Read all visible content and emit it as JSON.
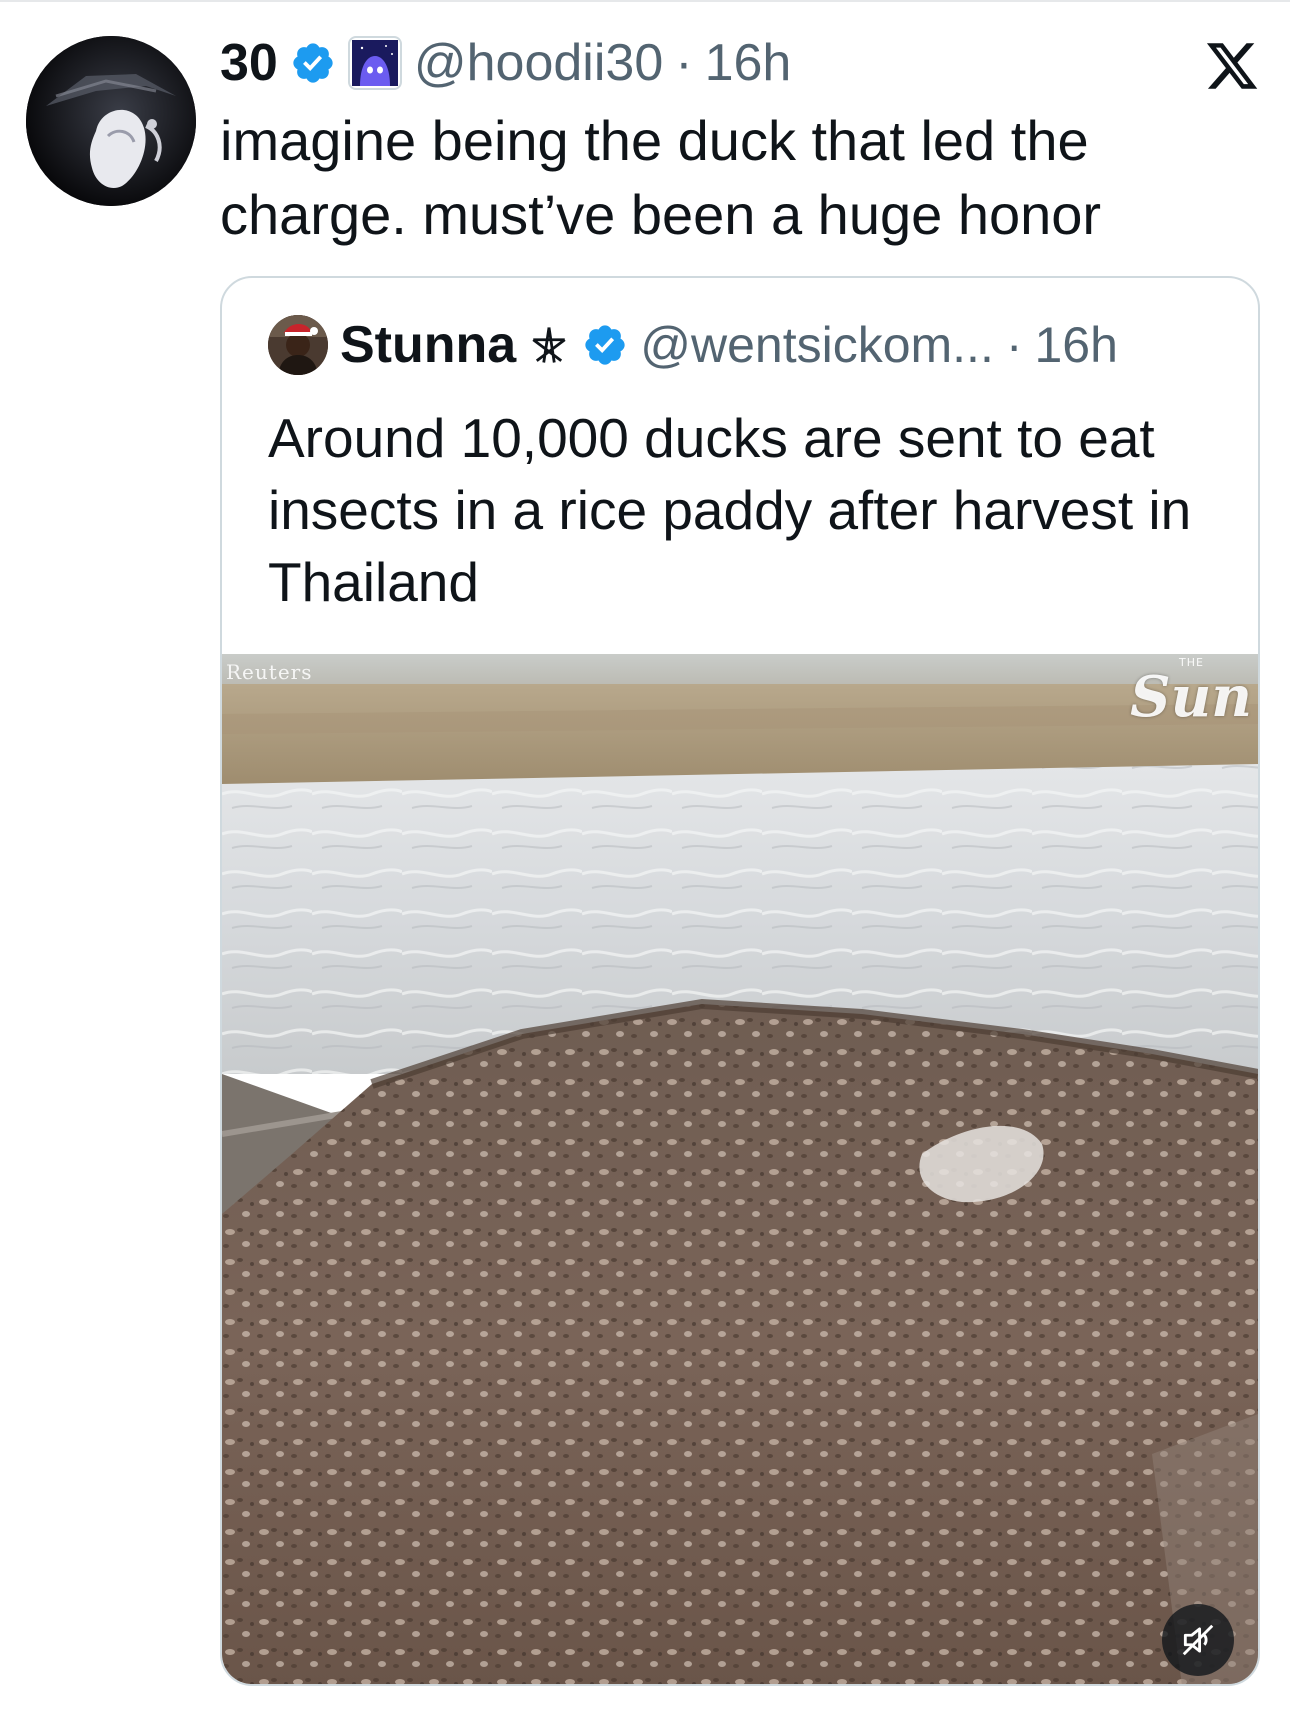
{
  "tweet": {
    "display_name": "30",
    "handle": "@hoodii30",
    "separator": "·",
    "time": "16h",
    "text": "imagine being the duck that led the charge. must’ve been a huge honor",
    "verified_icon": "verified-badge-icon",
    "affiliation_icon": "affiliate-badge-icon",
    "brand_icon": "x-logo-icon"
  },
  "quote": {
    "display_name": "Stunna",
    "name_symbol": "pentagram-icon",
    "handle": "@wentsickom...",
    "separator": "·",
    "time": "16h",
    "text": "Around 10,000 ducks are sent to eat insects in a rice paddy after harvest in Thailand",
    "media": {
      "watermark_left": "Reuters",
      "watermark_right": "Sun",
      "watermark_right_small": "THE",
      "mute_icon": "speaker-muted-icon"
    }
  },
  "colors": {
    "text_primary": "#0f1419",
    "text_secondary": "#536471",
    "verified_blue": "#1d9bf0",
    "border": "#cfd9de"
  }
}
